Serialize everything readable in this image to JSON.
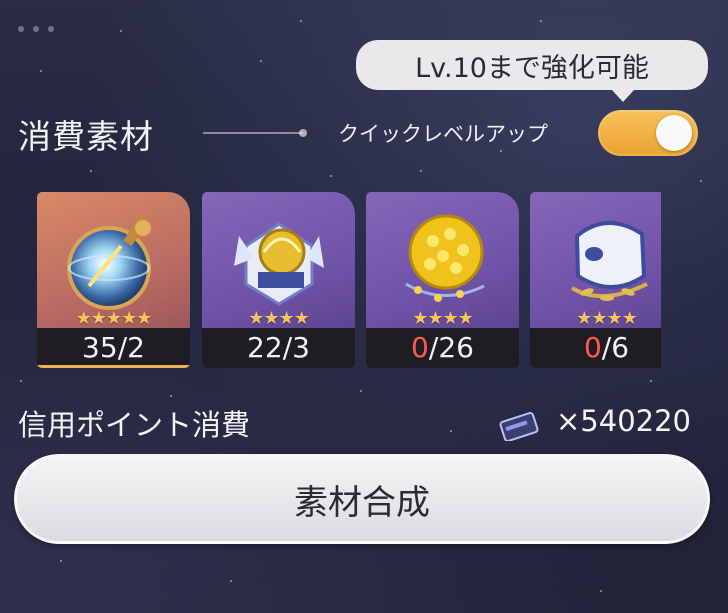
{
  "header": {
    "tooltip": "Lv.10まで強化可能"
  },
  "section": {
    "title": "消費素材",
    "quick_level_up_label": "クイックレベルアップ",
    "quick_level_up_enabled": true,
    "toggle_color": "#eaa330"
  },
  "materials": [
    {
      "name_icon": "compass-orb-icon",
      "rarity_stars": 5,
      "owned": "35",
      "required": "2",
      "owned_color": "#f1f1f1",
      "bg": "gold"
    },
    {
      "name_icon": "golden-core-icon",
      "rarity_stars": 4,
      "owned": "22",
      "required": "3",
      "owned_color": "#f1f1f1",
      "bg": "purple"
    },
    {
      "name_icon": "golden-flower-icon",
      "rarity_stars": 4,
      "owned": "0",
      "required": "26",
      "owned_color": "#ff5a4a",
      "bg": "purple"
    },
    {
      "name_icon": "laurel-mask-icon",
      "rarity_stars": 4,
      "owned": "0",
      "required": "6",
      "owned_color": "#ff5a4a",
      "bg": "purple"
    }
  ],
  "credits": {
    "label": "信用ポイント消費",
    "value": "×540220",
    "icon": "credit-card-icon"
  },
  "actions": {
    "synthesize_label": "素材合成"
  }
}
